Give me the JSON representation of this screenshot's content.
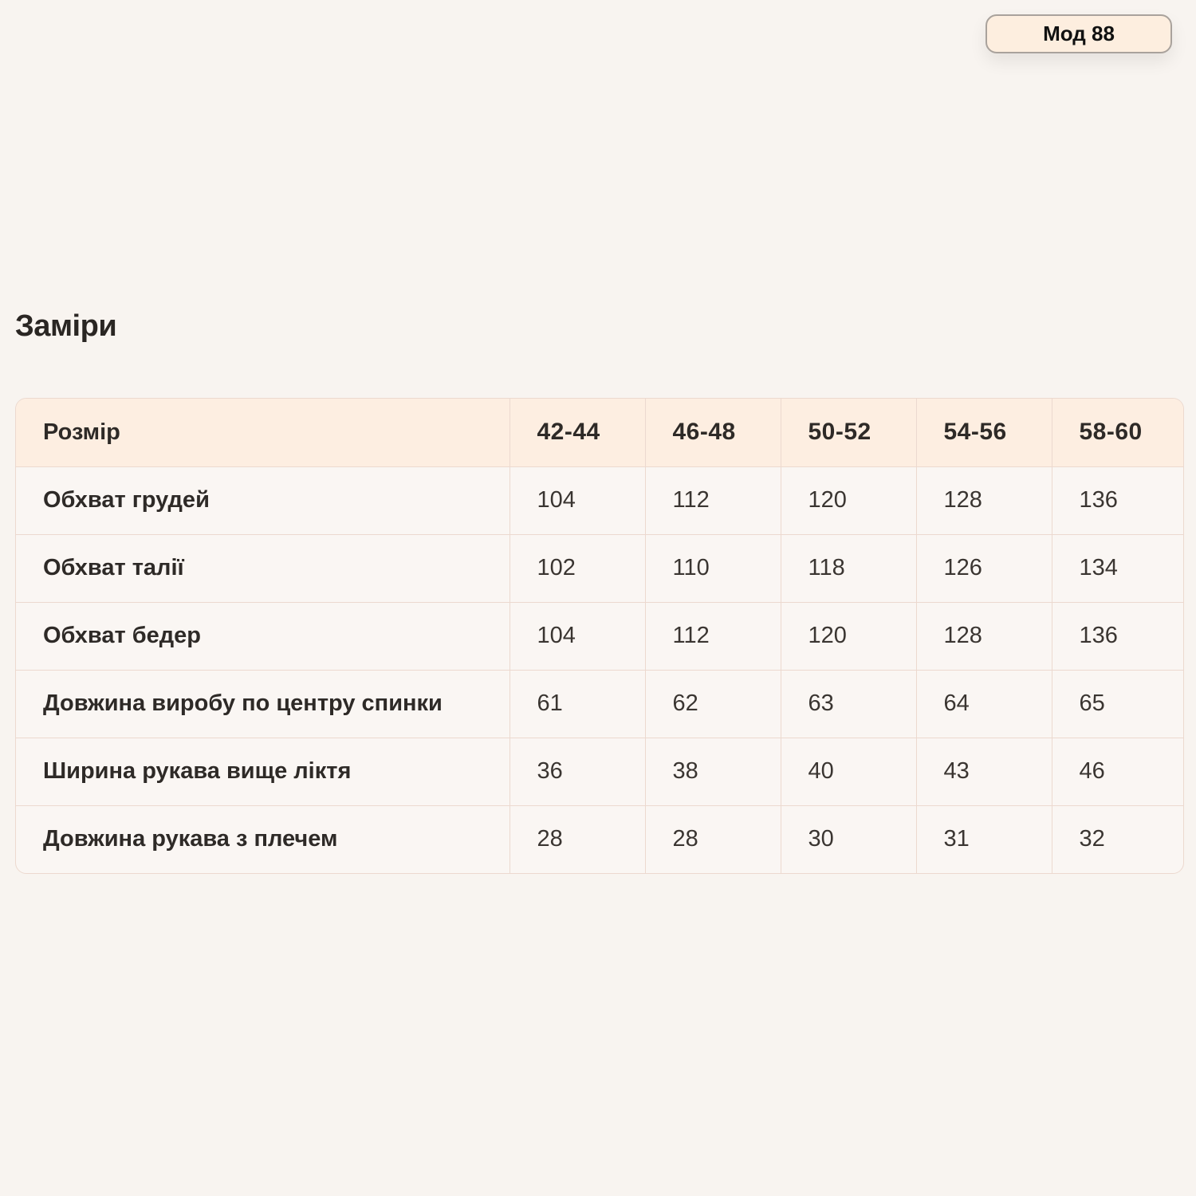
{
  "badge": {
    "label": "Мод 88"
  },
  "section": {
    "title": "Заміри"
  },
  "table": {
    "header": {
      "label": "Розмір",
      "sizes": [
        "42-44",
        "46-48",
        "50-52",
        "54-56",
        "58-60"
      ]
    },
    "rows": [
      {
        "label": "Обхват грудей",
        "values": [
          "104",
          "112",
          "120",
          "128",
          "136"
        ]
      },
      {
        "label": "Обхват талії",
        "values": [
          "102",
          "110",
          "118",
          "126",
          "134"
        ]
      },
      {
        "label": "Обхват бедер",
        "values": [
          "104",
          "112",
          "120",
          "128",
          "136"
        ]
      },
      {
        "label": "Довжина виробу по центру спинки",
        "values": [
          "61",
          "62",
          "63",
          "64",
          "65"
        ]
      },
      {
        "label": "Ширина рукава вище ліктя",
        "values": [
          "36",
          "38",
          "40",
          "43",
          "46"
        ]
      },
      {
        "label": "Довжина рукава з плечем",
        "values": [
          "28",
          "28",
          "30",
          "31",
          "32"
        ]
      }
    ]
  },
  "colors": {
    "background": "#f8f4f0",
    "header_fill": "#fdeee1",
    "grid_line": "#ecd9cf",
    "badge_fill": "#fdeedf",
    "text": "#2e2a27"
  }
}
